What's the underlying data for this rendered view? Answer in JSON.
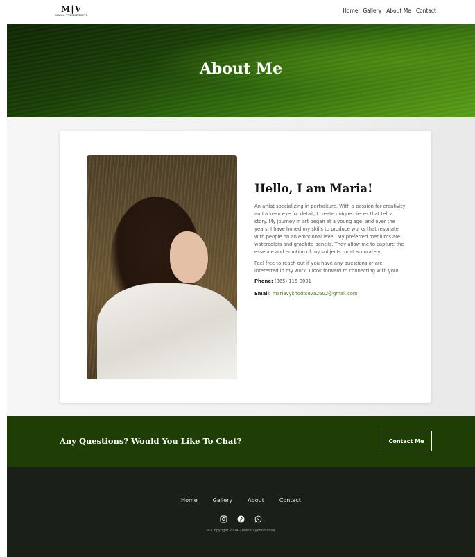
{
  "header": {
    "logo_mark": "M|V",
    "logo_subtitle": "MARIA VYKHODTSEVA",
    "nav": [
      "Home",
      "Gallery",
      "About Me",
      "Contact"
    ]
  },
  "hero": {
    "title": "About Me"
  },
  "about": {
    "greeting": "Hello, I am Maria!",
    "paragraph_1": "An artist specializing in portraiture. With a passion for creativity and a keen eye for detail, I create unique pieces that tell a story. My journey in art began at a young age, and over the years, I have honed my skills to produce works that resonate with people on an emotional level. My preferred mediums are watercolors and graphite pencils. They allow me to capture the essence and emotion of my subjects most accurately.",
    "paragraph_2": "Feel free to reach out if you have any questions or are interested in my work. I look forward to connecting with you!",
    "phone_label": "Phone:",
    "phone_value": "(065) 115-3031",
    "email_label": "Email:",
    "email_value": "mariavykhodtseva2602@gmail.com"
  },
  "cta": {
    "title": "Any Questions? Would You Like To Chat?",
    "button_label": "Contact Me"
  },
  "footer": {
    "nav": [
      "Home",
      "Gallery",
      "About",
      "Contact"
    ],
    "social_icons": [
      "instagram-icon",
      "pinterest-icon",
      "whatsapp-icon"
    ],
    "copyright": "© Copyright 2024 - Maria Vykhodtseva"
  },
  "colors": {
    "accent_green": "#1f3e05",
    "footer_dark": "#1a1f18",
    "email_green": "#4d7a20"
  }
}
